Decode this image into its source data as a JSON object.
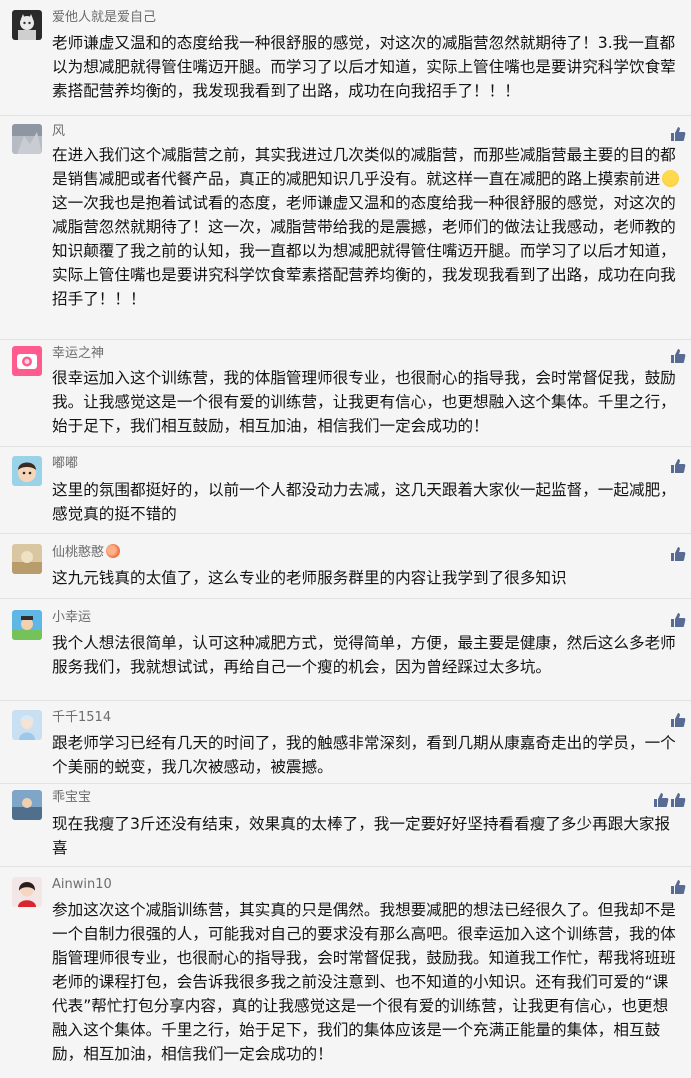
{
  "comments": [
    {
      "name": "爱他人就是爱自己",
      "text": "老师谦虚又温和的态度给我一种很舒服的感觉，对这次的减脂营忽然就期待了！3.我一直都以为想减肥就得管住嘴迈开腿。而学习了以后才知道，实际上管住嘴也是要讲究科学饮食荤素搭配营养均衡的，我发现我看到了出路，成功在向我招手了！！！"
    },
    {
      "name": "风",
      "text_part1": "在进入我们这个减脂营之前，其实我进过几次类似的减脂营，而那些减脂营最主要的目的都是销售减肥或者代餐产品，真正的减肥知识几乎没有。就这样一直在减肥的路上摸索前进",
      "text_part2": "这一次我也是抱着试试看的态度，老师谦虚又温和的态度给我一种很舒服的感觉，对这次的减脂营忽然就期待了！这一次，减脂营带给我的是震撼，老师们的做法让我感动，老师教的知识颠覆了我之前的认知，我一直都以为想减肥就得管住嘴迈开腿。而学习了以后才知道，实际上管住嘴也是要讲究科学饮食荤素搭配营养均衡的，我发现我看到了出路，成功在向我招手了！！！"
    },
    {
      "name": "幸运之神",
      "text": "很幸运加入这个训练营，我的体脂管理师很专业，也很耐心的指导我，会时常督促我，鼓励我。让我感觉这是一个很有爱的训练营，让我更有信心，也更想融入这个集体。千里之行，始于足下，我们相互鼓励，相互加油，相信我们一定会成功的！"
    },
    {
      "name": "嘟嘟",
      "text": "这里的氛围都挺好的，以前一个人都没动力去减，这几天跟着大家伙一起监督，一起减肥，感觉真的挺不错的"
    },
    {
      "name": "仙桃憨憨",
      "text": "这九元钱真的太值了，这么专业的老师服务群里的内容让我学到了很多知识"
    },
    {
      "name": "小幸运",
      "text": "我个人想法很简单，认可这种减肥方式，觉得简单，方便，最主要是健康，然后这么多老师服务我们，我就想试试，再给自己一个瘦的机会，因为曾经踩过太多坑。"
    },
    {
      "name": "千千1514",
      "text": "跟老师学习已经有几天的时间了，我的触感非常深刻，看到几期从康嘉奇走出的学员，一个个美丽的蜕变，我几次被感动，被震撼。"
    },
    {
      "name": "乖宝宝",
      "text": "现在我瘦了3斤还没有结束，效果真的太棒了，我一定要好好坚持看看瘦了多少再跟大家报喜"
    },
    {
      "name": "Ainwin10",
      "text": "参加这次这个减脂训练营，其实真的只是偶然。我想要减肥的想法已经很久了。但我却不是一个自制力很强的人，可能我对自己的要求没有那么高吧。很幸运加入这个训练营，我的体脂管理师很专业，也很耐心的指导我，会时常督促我，鼓励我。知道我工作忙，帮我将班班老师的课程打包，会告诉我很多我之前没注意到、也不知道的小知识。还有我们可爱的“课代表”帮忙打包分享内容，真的让我感觉这是一个很有爱的训练营，让我更有信心，也更想融入这个集体。千里之行，始于足下，我们的集体应该是一个充满正能量的集体，相互鼓励，相互加油，相信我们一定会成功的！"
    }
  ],
  "icons": {
    "like": "thumbs-up-icon",
    "peach_emoji": "peach-emoji-icon",
    "pensive_emoji": "pensive-face-emoji-icon"
  },
  "colors": {
    "background": "#f5f5f5",
    "name_text": "#6d6d6d",
    "body_text": "#131313",
    "like_icon": "#576b95"
  }
}
